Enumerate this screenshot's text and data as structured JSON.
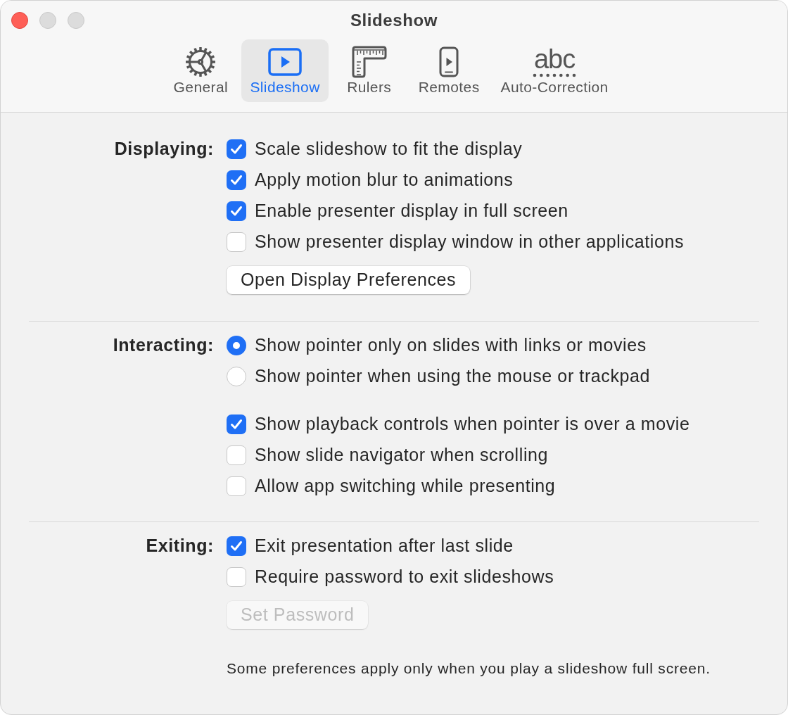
{
  "window": {
    "title": "Slideshow",
    "controls": [
      {
        "kind": "close",
        "disabled": false
      },
      {
        "kind": "minimize",
        "disabled": true
      },
      {
        "kind": "zoom",
        "disabled": true
      }
    ]
  },
  "tabs": [
    {
      "label": "General",
      "kind": "gear",
      "selected": false
    },
    {
      "label": "Slideshow",
      "kind": "slideshow",
      "selected": true
    },
    {
      "label": "Rulers",
      "kind": "ruler",
      "selected": false
    },
    {
      "label": "Remotes",
      "kind": "remote",
      "selected": false
    },
    {
      "label": "Auto-Correction",
      "kind": "text",
      "icon_text": "abc",
      "selected": false
    }
  ],
  "sections": [
    {
      "label": "Displaying:",
      "items": [
        {
          "kind": "checkbox",
          "label": "Scale slideshow to fit the display",
          "checked": true
        },
        {
          "kind": "checkbox",
          "label": "Apply motion blur to animations",
          "checked": true
        },
        {
          "kind": "checkbox",
          "label": "Enable presenter display in full screen",
          "checked": true
        },
        {
          "kind": "checkbox",
          "label": "Show presenter display window in other applications",
          "checked": false
        },
        {
          "kind": "button",
          "label": "Open Display Preferences",
          "disabled": false
        }
      ]
    },
    {
      "label": "Interacting:",
      "items": [
        {
          "kind": "radio",
          "label": "Show pointer only on slides with links or movies",
          "selected": true
        },
        {
          "kind": "radio",
          "label": "Show pointer when using the mouse or trackpad",
          "selected": false
        },
        {
          "kind": "checkbox",
          "label": "Show playback controls when pointer is over a movie",
          "checked": true
        },
        {
          "kind": "checkbox",
          "label": "Show slide navigator when scrolling",
          "checked": false
        },
        {
          "kind": "checkbox",
          "label": "Allow app switching while presenting",
          "checked": false
        }
      ]
    },
    {
      "label": "Exiting:",
      "items": [
        {
          "kind": "checkbox",
          "label": "Exit presentation after last slide",
          "checked": true
        },
        {
          "kind": "checkbox",
          "label": "Require password to exit slideshows",
          "checked": false
        },
        {
          "kind": "button",
          "label": "Set Password",
          "disabled": true
        }
      ]
    }
  ],
  "note": "Some preferences apply only when you play a slideshow full screen."
}
